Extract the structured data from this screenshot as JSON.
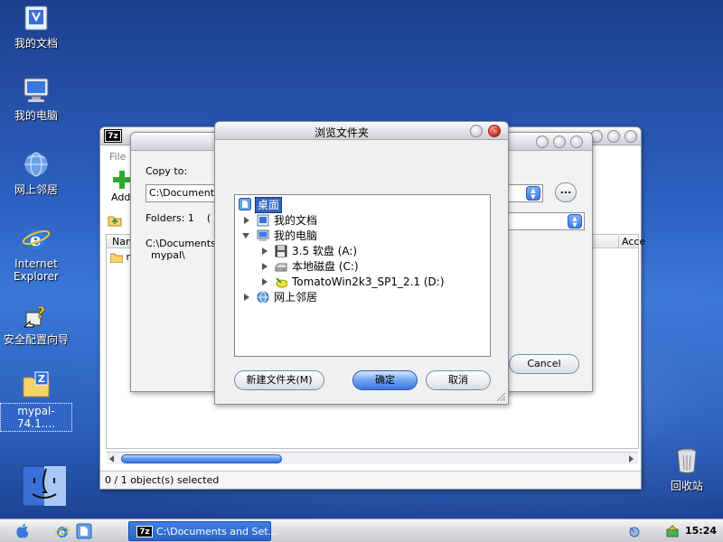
{
  "desktop": {
    "icons": [
      {
        "label": "我的文档"
      },
      {
        "label": "我的电脑"
      },
      {
        "label": "网上邻居"
      },
      {
        "label": "Internet Explorer"
      },
      {
        "label": "安全配置向导"
      },
      {
        "label": "mypal-74.1...."
      },
      {
        "label": "回收站"
      }
    ]
  },
  "main_window": {
    "app_badge": "7z",
    "menu_file": "File",
    "toolbar_add": "Add",
    "column_name": "Nam",
    "column_accessed": "Acce",
    "list_item": "m",
    "status": "0 / 1 object(s) selected"
  },
  "copy_dialog": {
    "copy_to_label": "Copy to:",
    "path_value": "C:\\Documents a",
    "browse_label": "...",
    "folders_info": "Folders: 1    ( 16",
    "source_path_line1": "C:\\Documents a",
    "source_path_line2": "mypal\\",
    "cancel_label": "Cancel"
  },
  "browse_dialog": {
    "title": "浏览文件夹",
    "tree": {
      "desktop": "桌面",
      "my_documents": "我的文档",
      "my_computer": "我的电脑",
      "floppy": "3.5 软盘 (A:)",
      "local_disk": "本地磁盘 (C:)",
      "cd_drive": "TomatoWin2k3_SP1_2.1 (D:)",
      "network": "网上邻居"
    },
    "new_folder_label": "新建文件夹(M)",
    "ok_label": "确定",
    "cancel_label": "取消"
  },
  "taskbar": {
    "task_badge": "7z",
    "task_label": "C:\\Documents and Set...",
    "clock": "15:24"
  },
  "colors": {
    "selection_blue": "#3165c8",
    "accent_blue": "#3c78e0"
  }
}
